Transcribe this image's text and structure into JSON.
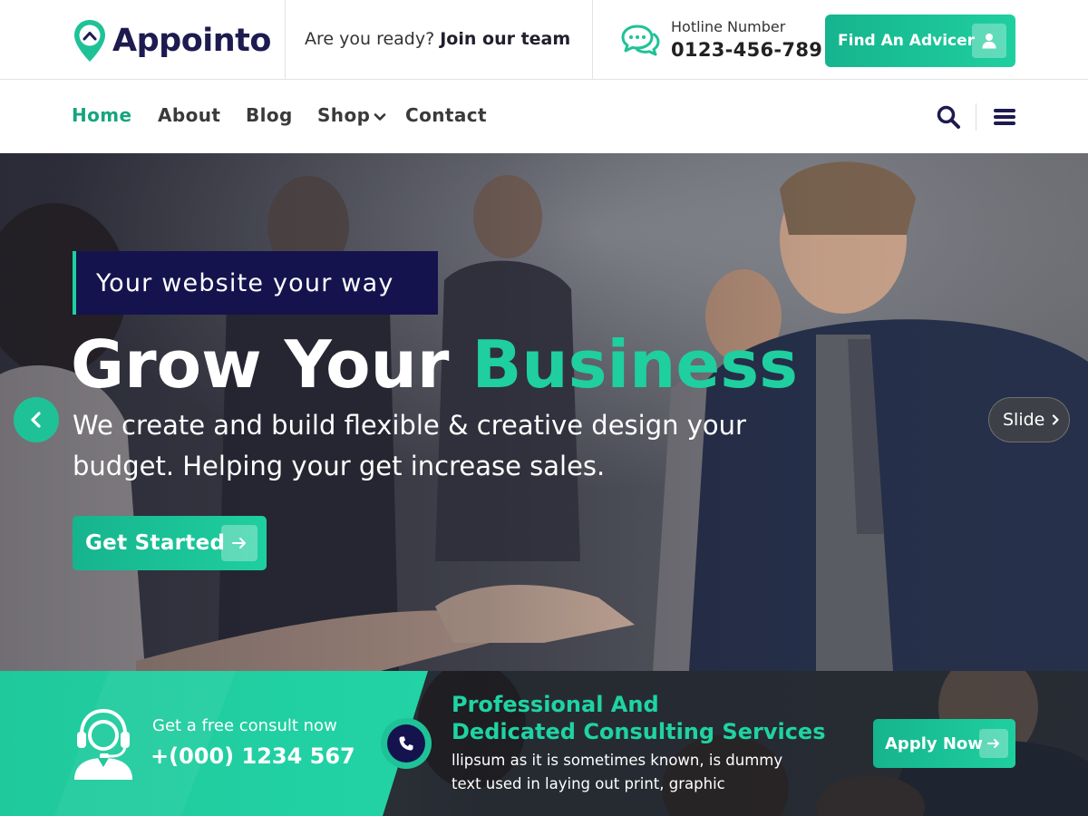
{
  "brand": {
    "name": "Appointo",
    "logo_icon": "map-pin-logo-icon"
  },
  "header": {
    "tagline_prefix": "Are you ready?",
    "tagline_bold": "Join our team",
    "hotline_label": "Hotline Number",
    "hotline_number": "0123-456-789",
    "hotline_icon": "chat-bubbles-icon",
    "cta_label": "Find An Advicer",
    "cta_icon": "user-icon"
  },
  "nav": {
    "items": [
      {
        "label": "Home",
        "active": true
      },
      {
        "label": "About",
        "active": false
      },
      {
        "label": "Blog",
        "active": false
      },
      {
        "label": "Shop",
        "active": false,
        "has_dropdown": true
      },
      {
        "label": "Contact",
        "active": false
      }
    ],
    "search_icon": "search-icon",
    "menu_icon": "hamburger-menu-icon"
  },
  "hero": {
    "tag": "Your website your way",
    "title_main": "Grow Your",
    "title_accent": "Business",
    "description": "We create and build flexible & creative design your budget. Helping your get increase sales.",
    "cta_label": "Get Started",
    "cta_icon": "arrow-right-icon",
    "prev_icon": "chevron-left-icon",
    "next_label": "Slide",
    "next_icon": "chevron-right-icon"
  },
  "band": {
    "consult_label": "Get a free consult now",
    "consult_phone": "+(000) 1234 567",
    "agent_icon": "support-agent-icon",
    "call_icon": "phone-icon",
    "title_line1": "Professional And",
    "title_line2": "Dedicated Consulting Services",
    "description": "llipsum as it is sometimes known, is dummy text used in laying out print, graphic",
    "apply_label": "Apply Now",
    "apply_icon": "arrow-right-icon"
  },
  "colors": {
    "accent": "#1fcf9f",
    "accent_dark": "#17a47f",
    "navy": "#14134e",
    "brand_text": "#1d1b4f"
  }
}
